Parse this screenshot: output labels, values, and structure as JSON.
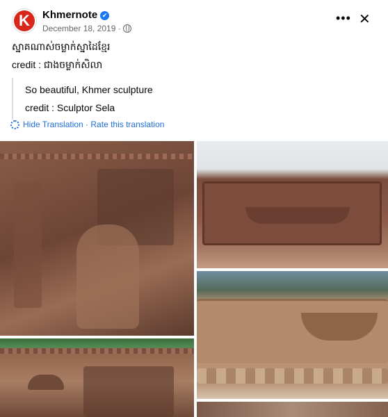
{
  "post": {
    "author": "Khmernote",
    "verified_mark": "✔",
    "date": "December 18, 2019 ·",
    "text_line1": "ស្នាគណាស់ចម្លាក់ស្នាដៃខ្មែរ",
    "text_line2": "credit :  ជាងចម្លាក់សិលា",
    "translation_line1": "So beautiful, Khmer sculpture",
    "translation_line2": "credit : Sculptor Sela",
    "hide_translation": "Hide Translation",
    "separator": " · ",
    "rate_translation": "Rate this translation",
    "more_label": "•••",
    "close_label": "✕"
  },
  "icons": [
    "khmernote-logo-icon",
    "verified-badge-icon",
    "globe-icon",
    "more-icon",
    "close-icon",
    "gear-icon"
  ],
  "colors": {
    "link": "#216fdb",
    "verified": "#1877f2",
    "logo": "#d9261c",
    "muted": "#65676b"
  }
}
